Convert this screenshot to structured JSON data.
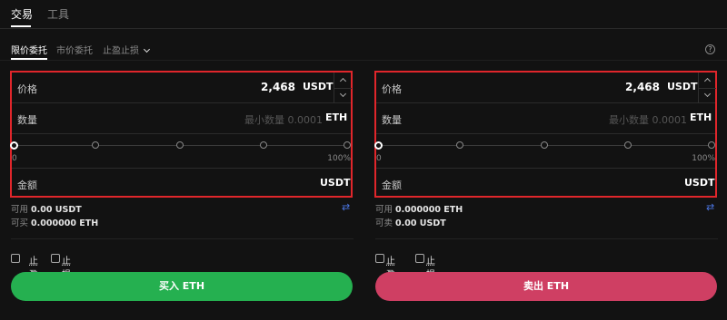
{
  "top_tabs": [
    "交易",
    "工具"
  ],
  "order_tabs": [
    "限价委托",
    "市价委托",
    "止盈止损"
  ],
  "help_icon": "help-circle-icon",
  "colors": {
    "highlight": "#e0262b",
    "buy": "#25b050",
    "sell": "#cf3f63",
    "swap": "#4a74e0"
  },
  "buy": {
    "price_label": "价格",
    "price_value": "2,468",
    "price_unit": "USDT",
    "amount_label": "数量",
    "amount_placeholder": "最小数量 0.0001",
    "amount_unit": "ETH",
    "slider_value_percent": 0,
    "slider_min": "0",
    "slider_max": "100%",
    "total_label": "金额",
    "total_unit": "USDT",
    "available_label": "可用",
    "available_value": "0.00 USDT",
    "can_trade_label": "可买",
    "can_trade_value": "0.000000 ETH",
    "tp_label": "止盈",
    "sl_label": "止损",
    "button_label": "买入 ETH"
  },
  "sell": {
    "price_label": "价格",
    "price_value": "2,468",
    "price_unit": "USDT",
    "amount_label": "数量",
    "amount_placeholder": "最小数量 0.0001",
    "amount_unit": "ETH",
    "slider_value_percent": 0,
    "slider_min": "0",
    "slider_max": "100%",
    "total_label": "金额",
    "total_unit": "USDT",
    "available_label": "可用",
    "available_value": "0.000000 ETH",
    "can_trade_label": "可卖",
    "can_trade_value": "0.00 USDT",
    "tp_label": "止盈",
    "sl_label": "止损",
    "button_label": "卖出 ETH"
  }
}
